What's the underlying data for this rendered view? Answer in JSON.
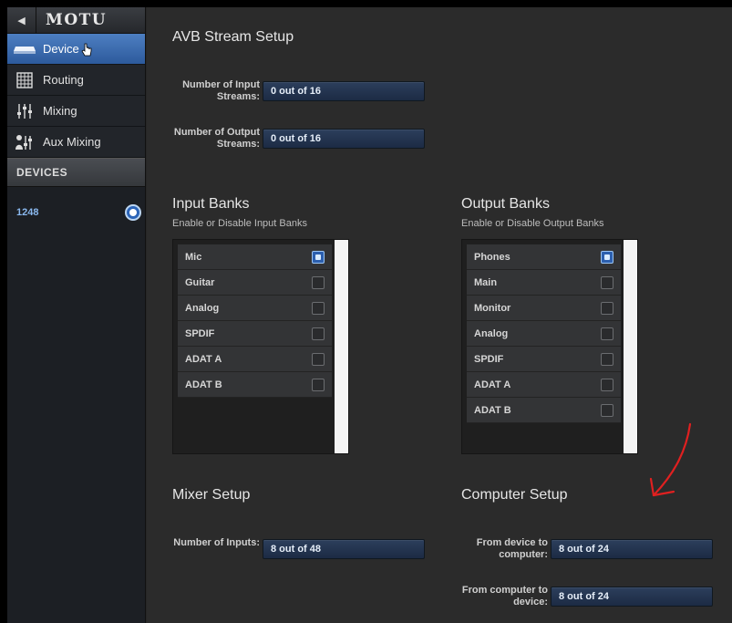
{
  "sidebar": {
    "brand": "MOTU",
    "nav": [
      {
        "label": "Device",
        "icon": "device-icon",
        "active": true
      },
      {
        "label": "Routing",
        "icon": "grid-icon",
        "active": false
      },
      {
        "label": "Mixing",
        "icon": "faders-icon",
        "active": false
      },
      {
        "label": "Aux Mixing",
        "icon": "aux-mix-icon",
        "active": false
      }
    ],
    "devices_header": "DEVICES",
    "devices": [
      {
        "name": "1248",
        "selected": true
      }
    ]
  },
  "avb": {
    "title": "AVB Stream Setup",
    "input_streams_label": "Number of Input Streams:",
    "input_streams_value": "0 out of 16",
    "output_streams_label": "Number of Output Streams:",
    "output_streams_value": "0 out of 16"
  },
  "input_banks": {
    "title": "Input Banks",
    "subtitle": "Enable or Disable Input Banks",
    "items": [
      {
        "label": "Mic",
        "enabled": true
      },
      {
        "label": "Guitar",
        "enabled": false
      },
      {
        "label": "Analog",
        "enabled": false
      },
      {
        "label": "SPDIF",
        "enabled": false
      },
      {
        "label": "ADAT A",
        "enabled": false
      },
      {
        "label": "ADAT B",
        "enabled": false
      }
    ]
  },
  "output_banks": {
    "title": "Output Banks",
    "subtitle": "Enable or Disable Output Banks",
    "items": [
      {
        "label": "Phones",
        "enabled": true
      },
      {
        "label": "Main",
        "enabled": false
      },
      {
        "label": "Monitor",
        "enabled": false
      },
      {
        "label": "Analog",
        "enabled": false
      },
      {
        "label": "SPDIF",
        "enabled": false
      },
      {
        "label": "ADAT A",
        "enabled": false
      },
      {
        "label": "ADAT B",
        "enabled": false
      }
    ]
  },
  "mixer": {
    "title": "Mixer Setup",
    "inputs_label": "Number of Inputs:",
    "inputs_value": "8 out of 48"
  },
  "computer": {
    "title": "Computer Setup",
    "to_computer_label": "From device to computer:",
    "to_computer_value": "8 out of 24",
    "to_device_label": "From computer to device:",
    "to_device_value": "8 out of 24"
  },
  "colors": {
    "accent": "#3a6fb8",
    "annotation": "#e02020"
  }
}
